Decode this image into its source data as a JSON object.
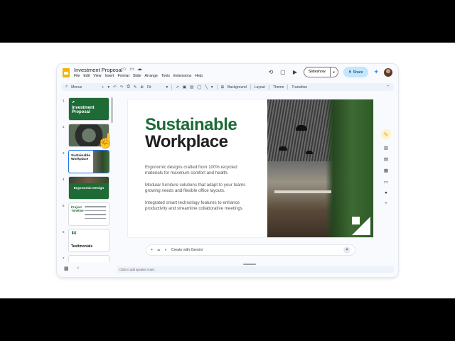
{
  "app": {
    "doc_title": "Investment Proposal",
    "title_icons": [
      "star-icon",
      "folder-move-icon",
      "cloud-status-icon"
    ],
    "menu": [
      "File",
      "Edit",
      "View",
      "Insert",
      "Format",
      "Slide",
      "Arrange",
      "Tools",
      "Extensions",
      "Help"
    ]
  },
  "header_right": {
    "slideshow_label": "Slideshow",
    "share_label": "Share",
    "icons": [
      "history-icon",
      "comment-icon",
      "video-meet-icon"
    ]
  },
  "toolbar": {
    "menus_label": "Menus",
    "zoom_label": "Fit",
    "background_label": "Background",
    "layout_label": "Layout",
    "theme_label": "Theme",
    "transition_label": "Transition"
  },
  "filmstrip": {
    "slides": [
      {
        "num": "1",
        "title": "Investment Proposal"
      },
      {
        "num": "2",
        "title": ""
      },
      {
        "num": "3",
        "title": "Sustainable Workplace"
      },
      {
        "num": "4",
        "title": "Ergonomic Design"
      },
      {
        "num": "5",
        "title": "Project Timeline"
      },
      {
        "num": "6",
        "title": "Testimonials",
        "quote": "“"
      },
      {
        "num": "7",
        "title": ""
      }
    ],
    "selected": 3
  },
  "slide": {
    "title_line1": "Sustainable",
    "title_line2": "Workplace",
    "para1": "Ergonomic designs crafted from 100% recycled materials for maximum comfort and health.",
    "para2": "Modular furniture solutions that adapt to your teams growing needs and flexible office layouts.",
    "para3": "Integrated smart technology features to enhance productivity and streamline collaborative meetings",
    "brand_green": "#1e6b36"
  },
  "gemini": {
    "placeholder": "Create with Gemini"
  },
  "notes": {
    "placeholder": "Click to add speaker notes"
  }
}
